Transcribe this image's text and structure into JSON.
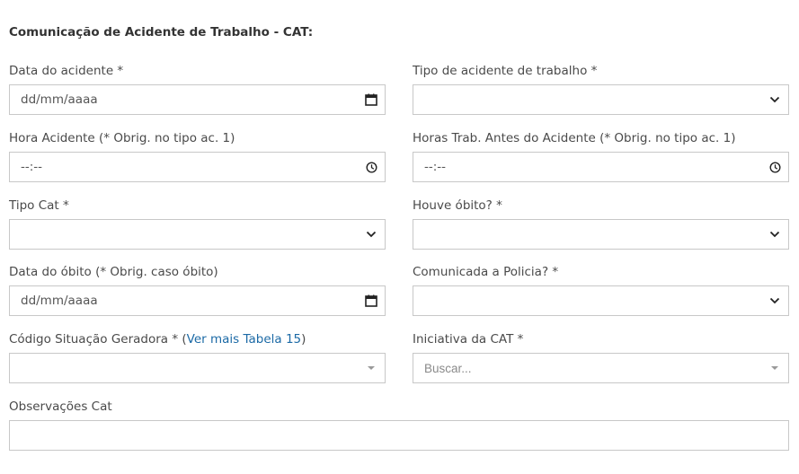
{
  "form": {
    "title": "Comunicação de Acidente de Trabalho - CAT:",
    "data_acidente": {
      "label": "Data do acidente *",
      "value": "dd/mm/aaaa"
    },
    "tipo_acidente": {
      "label": "Tipo de acidente de trabalho *",
      "value": ""
    },
    "hora_acidente": {
      "label": "Hora Acidente (* Obrig. no tipo ac. 1)",
      "value": "--:--"
    },
    "horas_trab": {
      "label": "Horas Trab. Antes do Acidente (* Obrig. no tipo ac. 1)",
      "value": "--:--"
    },
    "tipo_cat": {
      "label": "Tipo Cat *",
      "value": ""
    },
    "houve_obito": {
      "label": "Houve óbito? *",
      "value": ""
    },
    "data_obito": {
      "label": "Data do óbito (* Obrig. caso óbito)",
      "value": "dd/mm/aaaa"
    },
    "comunicada_policia": {
      "label": "Comunicada a Policia? *",
      "value": ""
    },
    "codigo_situacao": {
      "label_prefix": "Código Situação Geradora * (",
      "link": "Ver mais Tabela 15",
      "label_suffix": ")",
      "value": ""
    },
    "iniciativa_cat": {
      "label": "Iniciativa da CAT *",
      "placeholder": "Buscar..."
    },
    "observacoes": {
      "label": "Observações Cat",
      "value": ""
    }
  },
  "icons": {
    "calendar": "calendar-icon",
    "clock": "clock-icon",
    "chevron": "chevron-down-icon",
    "caret": "caret-down-icon"
  }
}
